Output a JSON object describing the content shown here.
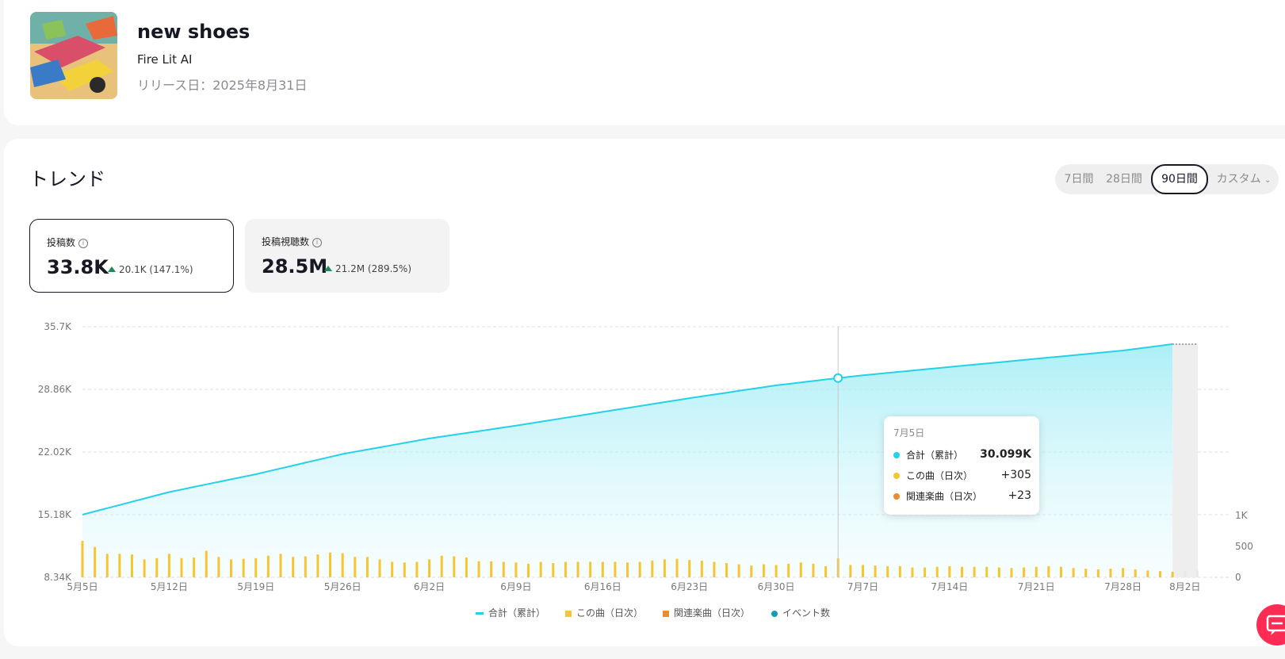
{
  "song": {
    "title": "new shoes",
    "artist": "Fire Lit AI",
    "release_date": "リリース日：2025年8月31日"
  },
  "trend": {
    "title": "トレンド",
    "ranges": [
      "7日間",
      "28日間",
      "90日間",
      "カスタム"
    ],
    "active_range": "90日間"
  },
  "metrics": [
    {
      "label": "投稿数",
      "value": "33.8K",
      "delta": "20.1K (147.1%)",
      "active": true
    },
    {
      "label": "投稿視聴数",
      "value": "28.5M",
      "delta": "21.2M (289.5%)",
      "active": false
    }
  ],
  "tooltip": {
    "date": "7月5日",
    "rows": [
      {
        "name": "合計（累計）",
        "value": "30.099K",
        "color": "#25d1e8"
      },
      {
        "name": "この曲（日次）",
        "value": "+305",
        "color": "#f7c530"
      },
      {
        "name": "関連楽曲（日次）",
        "value": "+23",
        "color": "#f08a2a"
      }
    ]
  },
  "legend": [
    {
      "name": "合計（累計）",
      "color": "#25d1e8",
      "shape": "line"
    },
    {
      "name": "この曲（日次）",
      "color": "#f7c530",
      "shape": "square"
    },
    {
      "name": "関連楽曲（日次）",
      "color": "#f08a2a",
      "shape": "square"
    },
    {
      "name": "イベント数",
      "color": "#0e9fb8",
      "shape": "dot"
    }
  ],
  "colors": {
    "cumulative_line": "#25d1e8",
    "daily_bar": "#f7c530",
    "grid": "#dcdcdc",
    "fab": "#fe2c55"
  },
  "chart_data": {
    "type": "line",
    "x_tick_labels": [
      "5月5日",
      "5月12日",
      "5月19日",
      "5月26日",
      "6月2日",
      "6月9日",
      "6月16日",
      "6月23日",
      "6月30日",
      "7月7日",
      "7月14日",
      "7月21日",
      "7月28日",
      "8月2日"
    ],
    "y_left_ticks": [
      "35.7K",
      "28.86K",
      "22.02K",
      "15.18K",
      "8.34K"
    ],
    "y_left_range": [
      8340,
      35700
    ],
    "y_right_ticks": [
      "1K",
      "500",
      "0"
    ],
    "y_right_range": [
      0,
      1000
    ],
    "cumulative_start": 15180,
    "cumulative_end": 33800,
    "cumulative_points": [
      {
        "day": 0,
        "value": 15180
      },
      {
        "day": 7,
        "value": 17650
      },
      {
        "day": 14,
        "value": 19600
      },
      {
        "day": 21,
        "value": 21800
      },
      {
        "day": 28,
        "value": 23500
      },
      {
        "day": 35,
        "value": 24900
      },
      {
        "day": 42,
        "value": 26400
      },
      {
        "day": 49,
        "value": 27900
      },
      {
        "day": 56,
        "value": 29300
      },
      {
        "day": 61,
        "value": 30099
      },
      {
        "day": 63,
        "value": 30400
      },
      {
        "day": 70,
        "value": 31300
      },
      {
        "day": 77,
        "value": 32200
      },
      {
        "day": 84,
        "value": 33100
      },
      {
        "day": 88,
        "value": 33800
      }
    ],
    "daily_values": [
      590,
      490,
      380,
      380,
      370,
      290,
      310,
      380,
      310,
      320,
      430,
      330,
      290,
      300,
      310,
      350,
      380,
      330,
      340,
      370,
      400,
      390,
      330,
      330,
      290,
      250,
      240,
      250,
      290,
      350,
      340,
      320,
      260,
      260,
      250,
      240,
      220,
      250,
      230,
      250,
      250,
      250,
      250,
      250,
      240,
      250,
      270,
      290,
      300,
      280,
      270,
      250,
      230,
      210,
      190,
      210,
      200,
      220,
      240,
      220,
      180,
      305,
      200,
      200,
      190,
      180,
      180,
      160,
      160,
      170,
      180,
      170,
      170,
      170,
      160,
      150,
      160,
      170,
      180,
      170,
      150,
      140,
      130,
      140,
      150,
      130,
      110,
      100,
      90
    ],
    "selected_day": 61,
    "partial_days_start": 89,
    "total_days": 91
  },
  "fab_icon": "chat-icon"
}
